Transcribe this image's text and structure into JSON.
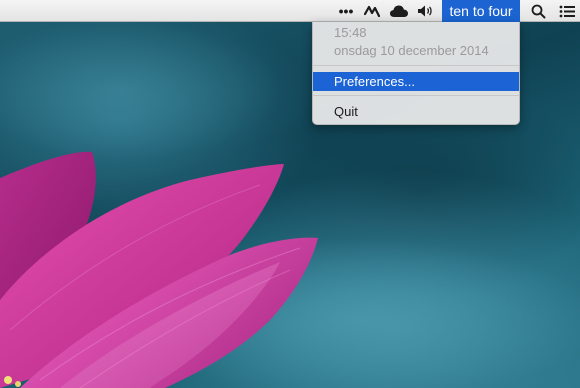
{
  "menubar": {
    "icons": {
      "more": "more-dots-icon",
      "activity": "activity-icon",
      "cloud": "cloud-icon",
      "volume": "volume-icon",
      "search": "spotlight-search-icon",
      "notifications": "notification-list-icon"
    },
    "more_label": "•••",
    "clock_label": "ten to four",
    "highlight_color": "#1b64d1"
  },
  "dropdown": {
    "time": "15:48",
    "date": "onsdag 10 december 2014",
    "items": [
      {
        "label": "Preferences...",
        "selected": true
      },
      {
        "label": "Quit",
        "selected": false
      }
    ]
  }
}
